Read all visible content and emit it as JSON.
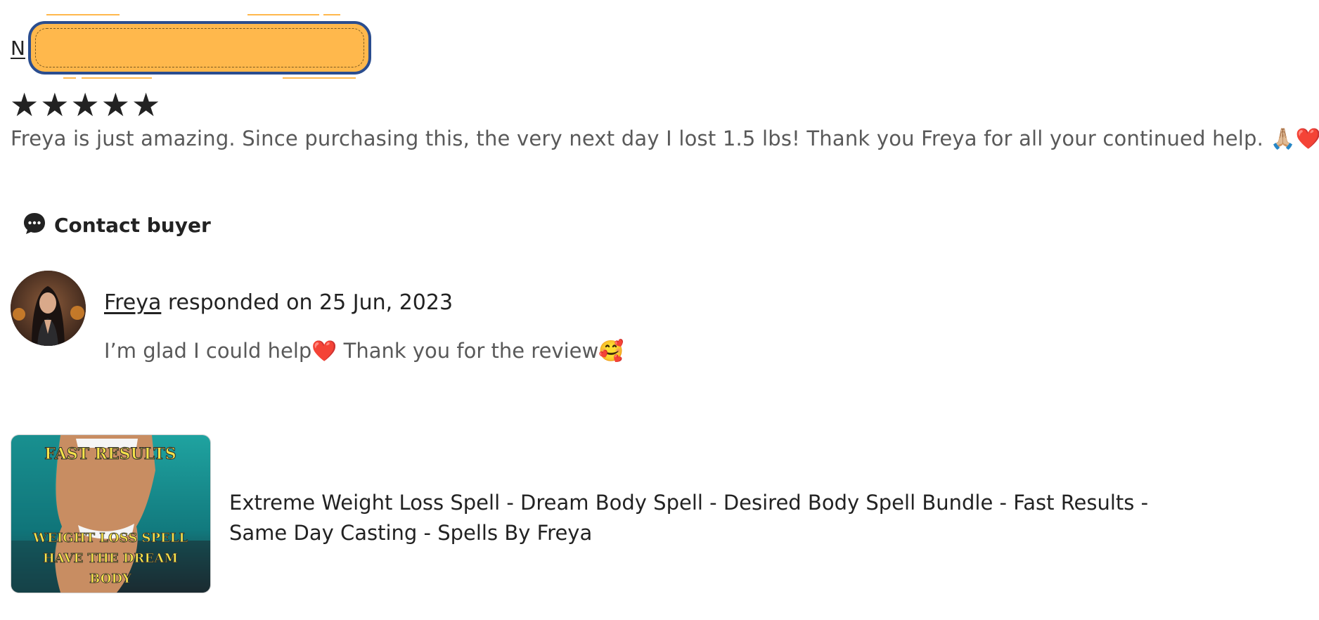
{
  "review": {
    "reviewer_initial": "N",
    "rating": 5,
    "stars": [
      "★",
      "★",
      "★",
      "★",
      "★"
    ],
    "text": "Freya is just amazing. Since purchasing this, the very next day I lost 1.5 lbs! Thank you Freya for all your continued help. 🙏🏼❤️❤️",
    "contact_buyer_label": "Contact buyer"
  },
  "response": {
    "responder_name": "Freya",
    "responded_label": " responded on 25 Jun, 2023",
    "text": "I’m glad I could help❤️ Thank you for the review🥰"
  },
  "listing": {
    "title": "Extreme Weight Loss Spell - Dream Body Spell - Desired Body Spell Bundle - Fast Results - Same Day Casting - Spells By Freya",
    "thumb_top_text": "FAST RESULTS",
    "thumb_bottom_lines": [
      "WEIGHT LOSS SPELL",
      "HAVE THE DREAM",
      "BODY"
    ]
  },
  "colors": {
    "highlight_fill": "#ffb84c",
    "highlight_border": "#2a4d8f",
    "muted_text": "#595959",
    "primary_text": "#222222"
  }
}
